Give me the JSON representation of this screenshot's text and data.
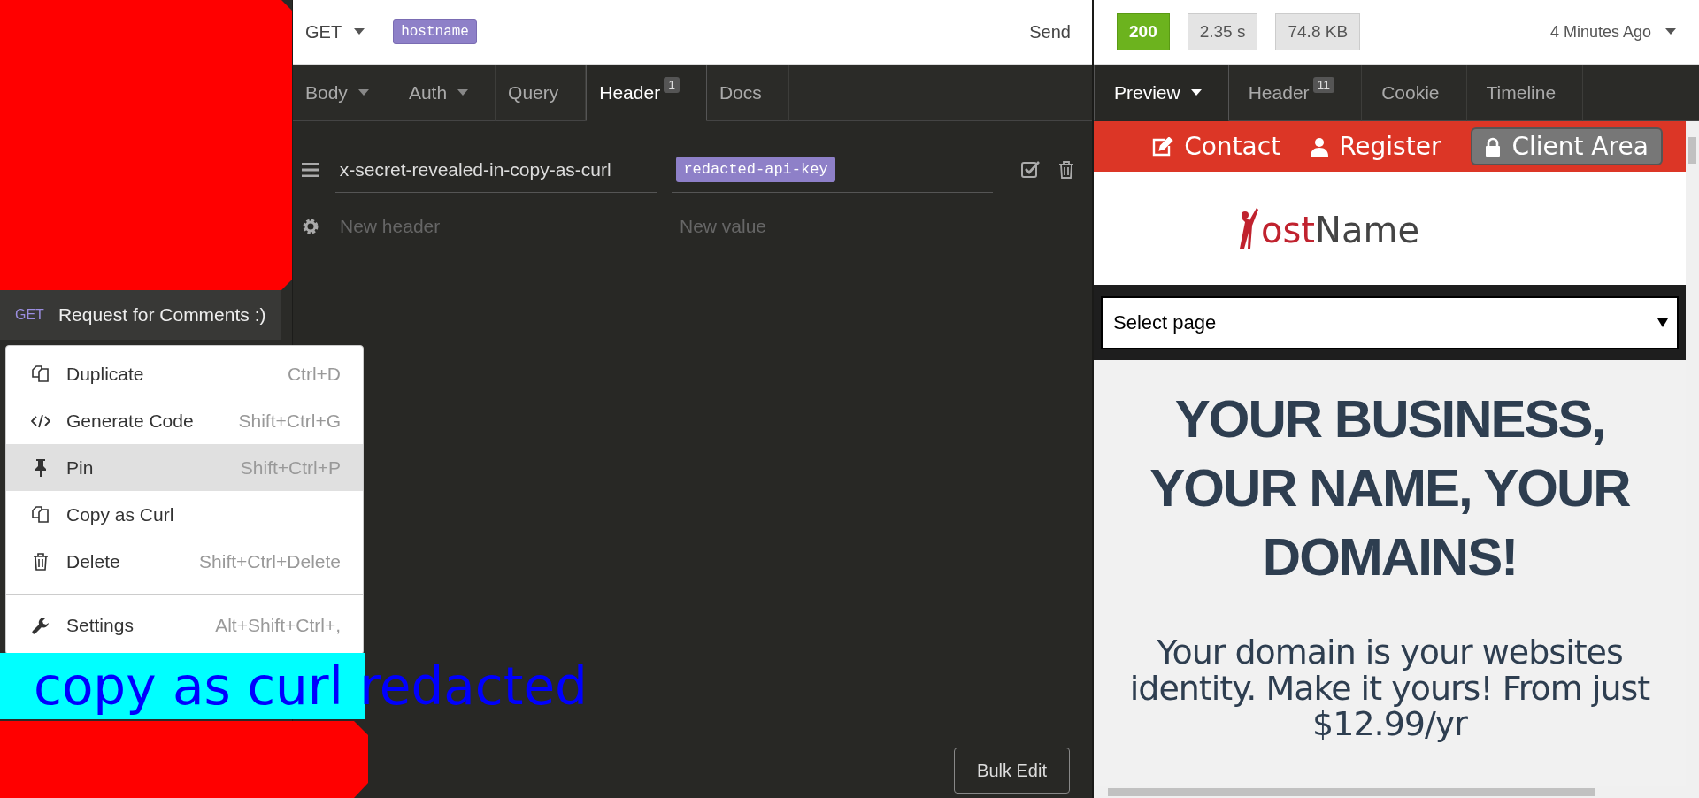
{
  "sidebar": {
    "request": {
      "method": "GET",
      "name": "Request for Comments :)"
    }
  },
  "context_menu": {
    "sections": [
      [
        {
          "kind": "duplicate",
          "label": "Duplicate",
          "shortcut": "Ctrl+D",
          "selected": false
        },
        {
          "kind": "code",
          "label": "Generate Code",
          "shortcut": "Shift+Ctrl+G",
          "selected": false
        },
        {
          "kind": "pin",
          "label": "Pin",
          "shortcut": "Shift+Ctrl+P",
          "selected": true
        },
        {
          "kind": "duplicate",
          "label": "Copy as Curl",
          "selected": false
        },
        {
          "kind": "delete",
          "label": "Delete",
          "shortcut": "Shift+Ctrl+Delete",
          "selected": false
        }
      ],
      [
        {
          "kind": "settings",
          "label": "Settings",
          "shortcut": "Alt+Shift+Ctrl+,",
          "selected": false
        }
      ]
    ]
  },
  "annotation": {
    "caption": "copy as curl redacted"
  },
  "request": {
    "method": "GET",
    "url_tag": "hostname",
    "send": "Send"
  },
  "request_tabs": [
    {
      "label": "Body",
      "dropdown": true,
      "selected": false
    },
    {
      "label": "Auth",
      "dropdown": true,
      "selected": false
    },
    {
      "label": "Query",
      "dropdown": false,
      "selected": false
    },
    {
      "label": "Header",
      "badge": "1",
      "dropdown": false,
      "selected": true
    },
    {
      "label": "Docs",
      "dropdown": false,
      "selected": false
    }
  ],
  "headers": [
    {
      "name": "x-secret-revealed-in-copy-as-curl",
      "value": "redacted-api-key",
      "enabled": true
    }
  ],
  "new_header": {
    "name_placeholder": "New header",
    "value_placeholder": "New value"
  },
  "bulk_edit": "Bulk Edit",
  "response": {
    "status": "200",
    "time": "2.35 s",
    "size": "74.8 KB",
    "age": "4 Minutes Ago"
  },
  "response_tabs": [
    {
      "label": "Preview",
      "dropdown": true,
      "selected": true
    },
    {
      "label": "Header",
      "badge": "11",
      "dropdown": false,
      "selected": false
    },
    {
      "label": "Cookie",
      "dropdown": false,
      "selected": false
    },
    {
      "label": "Timeline",
      "dropdown": false,
      "selected": false
    }
  ],
  "preview": {
    "nav": [
      {
        "kind": "contact",
        "label": "Contact",
        "selected": false
      },
      {
        "kind": "register",
        "label": "Register",
        "selected": false
      },
      {
        "kind": "client",
        "label": "Client Area",
        "selected": true
      }
    ],
    "logo": {
      "accent": "ost",
      "rest": "Name"
    },
    "select": "Select page",
    "headline": "YOUR BUSINESS, YOUR NAME, YOUR DOMAINS!",
    "paragraph": "Your domain is your websites identity. Make it yours! From just $12.99/yr"
  }
}
